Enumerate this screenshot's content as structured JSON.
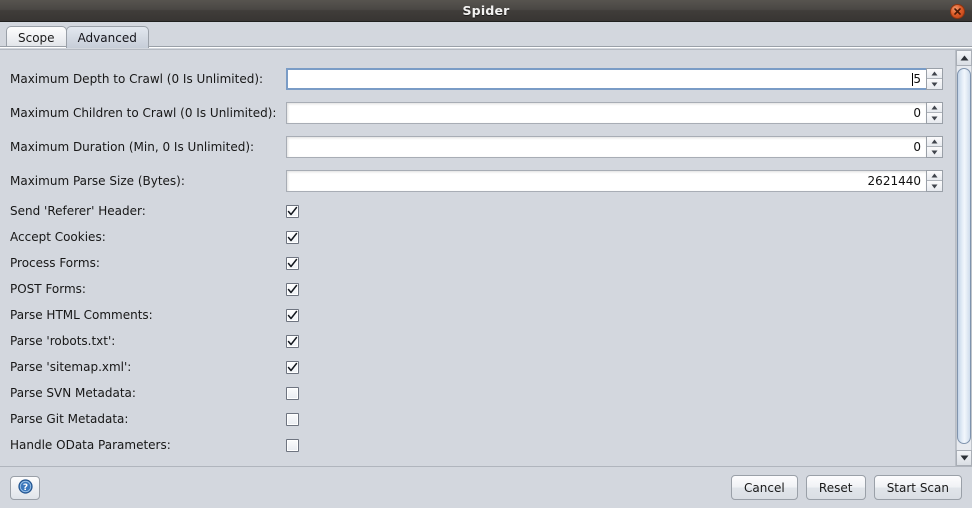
{
  "window": {
    "title": "Spider",
    "close_icon": "close-icon"
  },
  "tabs": [
    {
      "label": "Scope",
      "active": false
    },
    {
      "label": "Advanced",
      "active": true
    }
  ],
  "form": {
    "spinners": [
      {
        "label": "Maximum Depth to Crawl (0 Is Unlimited):",
        "value": "5",
        "focused": true
      },
      {
        "label": "Maximum Children to Crawl (0 Is Unlimited):",
        "value": "0",
        "focused": false
      },
      {
        "label": "Maximum Duration (Min, 0 Is Unlimited):",
        "value": "0",
        "focused": false
      },
      {
        "label": "Maximum Parse Size (Bytes):",
        "value": "2621440",
        "focused": false
      }
    ],
    "checkboxes": [
      {
        "label": "Send 'Referer' Header:",
        "checked": true
      },
      {
        "label": "Accept Cookies:",
        "checked": true
      },
      {
        "label": "Process Forms:",
        "checked": true
      },
      {
        "label": "POST Forms:",
        "checked": true
      },
      {
        "label": "Parse HTML Comments:",
        "checked": true
      },
      {
        "label": "Parse 'robots.txt':",
        "checked": true
      },
      {
        "label": "Parse 'sitemap.xml':",
        "checked": true
      },
      {
        "label": "Parse SVN Metadata:",
        "checked": false
      },
      {
        "label": "Parse Git Metadata:",
        "checked": false
      },
      {
        "label": "Handle OData Parameters:",
        "checked": false
      }
    ]
  },
  "scrollbar": {
    "up_icon": "scroll-up-arrow-icon",
    "down_icon": "scroll-down-arrow-icon"
  },
  "footer": {
    "help_icon": "help-question-icon",
    "buttons": [
      {
        "label": "Cancel"
      },
      {
        "label": "Reset"
      },
      {
        "label": "Start Scan"
      }
    ]
  },
  "colors": {
    "window_bg": "#d3d7de",
    "titlebar": "#45423f",
    "close_button": "#dd5b28",
    "focus_border": "#7a9cc6",
    "scroll_thumb": "#cfdcec"
  }
}
